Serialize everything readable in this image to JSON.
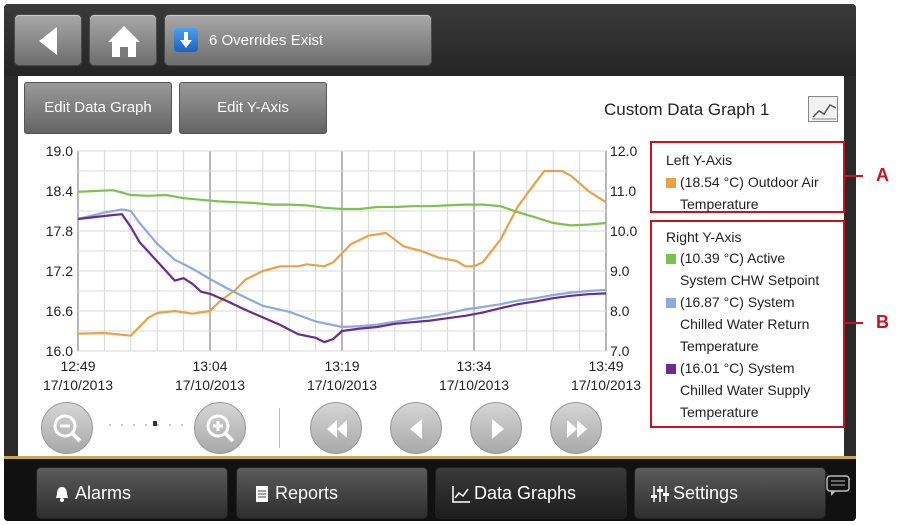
{
  "topbar": {
    "override_label": "6 Overrides Exist"
  },
  "toolbar": {
    "edit_data_graph": "Edit Data Graph",
    "edit_y_axis": "Edit Y-Axis",
    "graph_title": "Custom Data Graph 1"
  },
  "legend": {
    "left_heading": "Left Y-Axis",
    "left_items": [
      {
        "lines": [
          "(18.54 °C) Outdoor Air",
          "Temperature"
        ],
        "color": "#e8a34a"
      }
    ],
    "right_heading": "Right Y-Axis",
    "right_items": [
      {
        "lines": [
          "(10.39 °C) Active",
          "System CHW Setpoint"
        ],
        "color": "#7cc24e"
      },
      {
        "lines": [
          "(16.87 °C) System",
          "Chilled Water Return",
          "Temperature"
        ],
        "color": "#8eaadb"
      },
      {
        "lines": [
          "(16.01 °C) System",
          "Chilled Water Supply",
          "Temperature"
        ],
        "color": "#6a2c91"
      }
    ]
  },
  "callouts": {
    "a": "A",
    "b": "B"
  },
  "nav": {
    "alarms": "Alarms",
    "reports": "Reports",
    "data_graphs": "Data Graphs",
    "settings": "Settings"
  },
  "chart_data": {
    "type": "line",
    "x_ticks": [
      {
        "time": "12:49",
        "date": "17/10/2013"
      },
      {
        "time": "13:04",
        "date": "17/10/2013"
      },
      {
        "time": "13:19",
        "date": "17/10/2013"
      },
      {
        "time": "13:34",
        "date": "17/10/2013"
      },
      {
        "time": "13:49",
        "date": "17/10/2013"
      }
    ],
    "x_minutes": [
      0,
      60
    ],
    "left_y": {
      "range": [
        16.0,
        19.0
      ],
      "ticks": [
        "16.0",
        "16.6",
        "17.2",
        "17.8",
        "18.4",
        "19.0"
      ]
    },
    "right_y": {
      "range": [
        7.0,
        12.0
      ],
      "ticks": [
        "7.0",
        "8.0",
        "9.0",
        "10.0",
        "11.0",
        "12.0"
      ]
    },
    "grid": true,
    "series": [
      {
        "axis": "left",
        "color": "#e8a34a",
        "x": [
          0,
          3,
          6,
          8,
          9,
          11,
          13,
          15,
          16,
          18,
          19,
          21,
          23,
          25,
          26,
          28,
          29,
          31,
          33,
          35,
          37,
          39,
          41,
          43,
          44,
          45,
          46,
          48,
          50,
          52,
          53,
          55,
          56,
          58,
          60
        ],
        "y": [
          16.26,
          16.27,
          16.23,
          16.5,
          16.57,
          16.6,
          16.56,
          16.6,
          16.73,
          16.93,
          17.07,
          17.2,
          17.27,
          17.27,
          17.3,
          17.27,
          17.33,
          17.6,
          17.73,
          17.77,
          17.57,
          17.5,
          17.4,
          17.35,
          17.27,
          17.27,
          17.33,
          17.67,
          18.17,
          18.53,
          18.7,
          18.7,
          18.63,
          18.4,
          18.23
        ]
      },
      {
        "axis": "right",
        "color": "#7cc24e",
        "x": [
          0,
          2,
          4,
          6,
          8,
          10,
          12,
          14,
          16,
          18,
          20,
          22,
          24,
          26,
          28,
          30,
          32,
          34,
          36,
          38,
          40,
          42,
          44,
          46,
          48,
          50,
          52,
          54,
          56,
          58,
          60
        ],
        "y": [
          10.98,
          11.0,
          11.02,
          10.9,
          10.88,
          10.9,
          10.82,
          10.78,
          10.74,
          10.72,
          10.7,
          10.66,
          10.66,
          10.64,
          10.58,
          10.55,
          10.55,
          10.6,
          10.6,
          10.62,
          10.62,
          10.64,
          10.66,
          10.66,
          10.62,
          10.47,
          10.34,
          10.2,
          10.14,
          10.16,
          10.2
        ]
      },
      {
        "axis": "right",
        "color": "#8eaadb",
        "x": [
          0,
          3,
          5,
          6,
          7,
          9,
          11,
          13,
          15,
          17,
          19,
          21,
          24,
          27,
          30,
          32,
          34,
          36,
          38,
          40,
          42,
          44,
          46,
          48,
          50,
          52,
          54,
          56,
          58,
          60
        ],
        "y": [
          10.3,
          10.46,
          10.54,
          10.5,
          10.2,
          9.68,
          9.28,
          9.06,
          8.8,
          8.56,
          8.34,
          8.13,
          7.98,
          7.74,
          7.6,
          7.62,
          7.66,
          7.73,
          7.8,
          7.86,
          7.94,
          8.04,
          8.1,
          8.17,
          8.26,
          8.32,
          8.4,
          8.46,
          8.5,
          8.53
        ]
      },
      {
        "axis": "right",
        "color": "#6a2c91",
        "x": [
          0,
          2,
          4,
          5,
          6,
          7,
          8,
          9,
          10,
          11,
          12,
          13,
          14,
          15,
          17,
          19,
          21,
          23,
          25,
          27,
          28,
          29,
          30,
          32,
          34,
          36,
          38,
          40,
          42,
          44,
          46,
          48,
          50,
          52,
          54,
          56,
          58,
          60
        ],
        "y": [
          10.3,
          10.35,
          10.4,
          10.42,
          10.1,
          9.72,
          9.48,
          9.24,
          9.0,
          8.76,
          8.82,
          8.68,
          8.48,
          8.43,
          8.24,
          8.03,
          7.84,
          7.65,
          7.42,
          7.33,
          7.22,
          7.3,
          7.5,
          7.56,
          7.6,
          7.68,
          7.72,
          7.76,
          7.82,
          7.88,
          7.96,
          8.07,
          8.17,
          8.24,
          8.32,
          8.38,
          8.42,
          8.44
        ]
      }
    ]
  }
}
